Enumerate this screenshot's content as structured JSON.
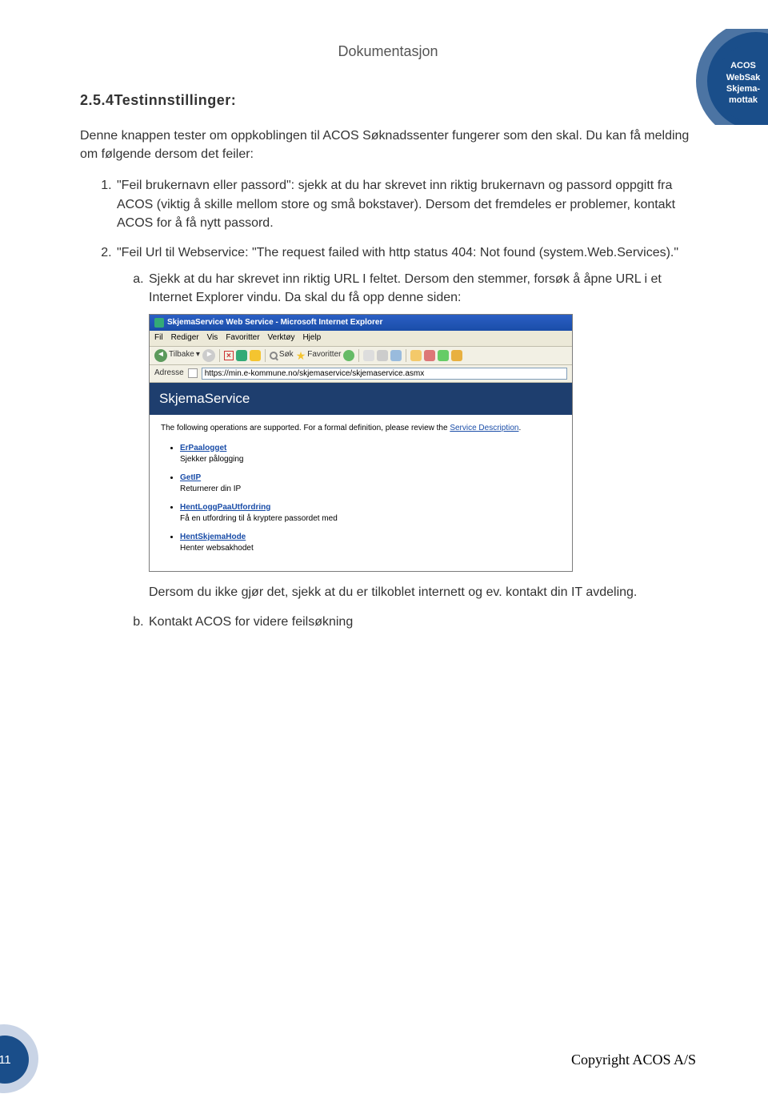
{
  "header": {
    "label": "Dokumentasjon"
  },
  "badge": {
    "line1": "ACOS",
    "line2": "WebSak",
    "line3": "Skjema-",
    "line4": "mottak"
  },
  "section": {
    "heading": "2.5.4Testinnstillinger:"
  },
  "intro": "Denne knappen tester om oppkoblingen til ACOS Søknadssenter fungerer som den skal. Du kan få melding om følgende dersom det feiler:",
  "items": [
    "\"Feil brukernavn eller passord\": sjekk at du har skrevet inn riktig brukernavn og passord oppgitt fra ACOS (viktig å skille mellom store og små bokstaver). Dersom det fremdeles er problemer, kontakt ACOS for å få nytt passord.",
    "\"Feil Url til Webservice: \"The request failed with http status 404: Not found (system.Web.Services).\""
  ],
  "subitems_a": "Sjekk at du har skrevet inn riktig URL I feltet. Dersom den stemmer, forsøk å åpne URL i et Internet Explorer vindu. Da skal du få opp denne siden:",
  "after_shot_text": "Dersom du ikke gjør det, sjekk at du er tilkoblet internett og ev. kontakt din IT avdeling.",
  "subitems_b": "Kontakt ACOS for videre feilsøkning",
  "screenshot": {
    "title": "SkjemaService Web Service - Microsoft Internet Explorer",
    "menus": [
      "Fil",
      "Rediger",
      "Vis",
      "Favoritter",
      "Verktøy",
      "Hjelp"
    ],
    "toolbar": {
      "back": "Tilbake",
      "search": "Søk",
      "fav": "Favoritter"
    },
    "address_label": "Adresse",
    "address_url": "https://min.e-kommune.no/skjemaservice/skjemaservice.asmx",
    "service_header": "SkjemaService",
    "supported_text_a": "The following operations are supported. For a formal definition, please review the ",
    "supported_link": "Service Description",
    "ops": [
      {
        "name": "ErPaalogget",
        "desc": "Sjekker pålogging"
      },
      {
        "name": "GetIP",
        "desc": "Returnerer din IP"
      },
      {
        "name": "HentLoggPaaUtfordring",
        "desc": "Få en utfordring til å kryptere passordet med"
      },
      {
        "name": "HentSkjemaHode",
        "desc": "Henter websakhodet"
      }
    ]
  },
  "footer": {
    "page": "11",
    "copyright": "Copyright ACOS A/S"
  }
}
